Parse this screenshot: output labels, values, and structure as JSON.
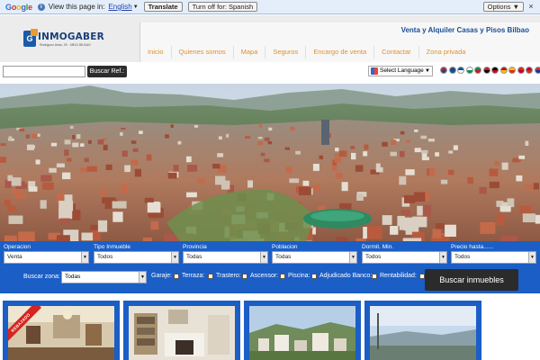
{
  "translate_bar": {
    "logo": "Google",
    "view_text": "View this page in:",
    "language": "English",
    "translate_label": "Translate",
    "turn_off_label": "Turn off for: Spanish",
    "options_label": "Options ▼",
    "close_label": "×"
  },
  "header": {
    "logo_name": "INMOGABER",
    "logo_tagline": "Rodriguez Arias, 39 · 48011 BILBAO",
    "slogan": "Venta y Alquiler Casas y Pisos Bilbao",
    "nav": [
      {
        "label": "Inicio"
      },
      {
        "label": "Quienes somos"
      },
      {
        "label": "Mapa"
      },
      {
        "label": "Seguros"
      },
      {
        "label": "Encargo de venta"
      },
      {
        "label": "Contactar"
      },
      {
        "label": "Zona privada"
      }
    ]
  },
  "search_row": {
    "ref_value": "",
    "ref_button": "Buscar Ref.:",
    "language_select": "Select Language",
    "flag_colors": [
      "#b22234",
      "#3c3b6e",
      "#0055a4",
      "#ffffff",
      "#009246",
      "#ce1126",
      "#000000",
      "#c60b1e",
      "#ffc400",
      "#de2910",
      "#bc002d",
      "#d52b1e",
      "#0039a6",
      "#d62612"
    ]
  },
  "filters": {
    "fields": [
      {
        "label": "Operacion",
        "value": "Venta"
      },
      {
        "label": "Tipo Inmueble",
        "value": "Todos"
      },
      {
        "label": "Provincia",
        "value": "Todas"
      },
      {
        "label": "Poblacion",
        "value": "Todas"
      },
      {
        "label": "Dormit. Min.",
        "value": "Todos"
      },
      {
        "label": "Precio hasta......",
        "value": "Todos"
      }
    ],
    "zona_label": "Buscar zona:",
    "zona_value": "Todas",
    "checkboxes": [
      {
        "label": "Garaje:"
      },
      {
        "label": "Terraza:"
      },
      {
        "label": "Trastero:"
      },
      {
        "label": "Ascensor:"
      },
      {
        "label": "Piscina:"
      },
      {
        "label": "Adjudicado Banco:"
      },
      {
        "label": "Rentabilidad:"
      }
    ],
    "search_button": "Buscar inmuebles"
  },
  "listings": [
    {
      "badge": "REBAJADO"
    },
    {
      "badge": ""
    },
    {
      "badge": ""
    },
    {
      "badge": ""
    }
  ]
}
